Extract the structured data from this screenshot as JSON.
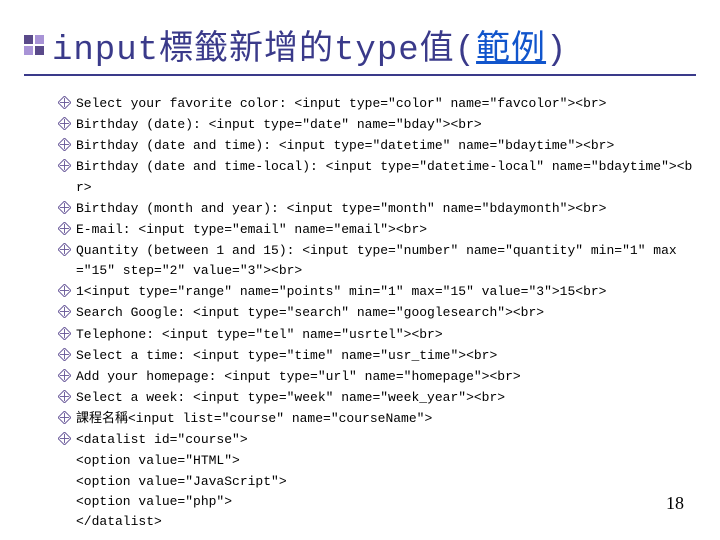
{
  "title": {
    "prefix": "input標籤新增的type值(",
    "link": "範例",
    "suffix": ")"
  },
  "lines": [
    {
      "b": true,
      "t": "Select your favorite color: <input type=\"color\" name=\"favcolor\"><br>"
    },
    {
      "b": true,
      "t": "Birthday (date): <input type=\"date\" name=\"bday\"><br>"
    },
    {
      "b": true,
      "t": "Birthday (date and time): <input type=\"datetime\" name=\"bdaytime\"><br>"
    },
    {
      "b": true,
      "t": "Birthday (date and time-local): <input type=\"datetime-local\" name=\"bdaytime\"><br>"
    },
    {
      "b": true,
      "t": "Birthday (month and year): <input type=\"month\" name=\"bdaymonth\"><br>"
    },
    {
      "b": true,
      "t": "E-mail: <input type=\"email\" name=\"email\"><br>"
    },
    {
      "b": true,
      "t": "Quantity (between 1 and 15): <input type=\"number\" name=\"quantity\" min=\"1\" max=\"15\" step=\"2\" value=\"3\"><br>"
    },
    {
      "b": true,
      "t": "1<input type=\"range\" name=\"points\" min=\"1\" max=\"15\" value=\"3\">15<br>"
    },
    {
      "b": true,
      "t": "Search Google: <input type=\"search\" name=\"googlesearch\"><br>"
    },
    {
      "b": true,
      "t": "Telephone: <input type=\"tel\" name=\"usrtel\"><br>"
    },
    {
      "b": true,
      "t": "Select a time: <input type=\"time\" name=\"usr_time\"><br>"
    },
    {
      "b": true,
      "t": "Add your homepage: <input type=\"url\" name=\"homepage\"><br>"
    },
    {
      "b": true,
      "t": "Select a week: <input type=\"week\" name=\"week_year\"><br>"
    },
    {
      "b": true,
      "t": "課程名稱<input list=\"course\" name=\"courseName\">"
    },
    {
      "b": true,
      "t": "<datalist id=\"course\">"
    },
    {
      "b": false,
      "t": "<option value=\"HTML\">"
    },
    {
      "b": false,
      "t": "<option value=\"JavaScript\">"
    },
    {
      "b": false,
      "t": "<option value=\"php\">"
    },
    {
      "b": false,
      "t": "</datalist>"
    }
  ],
  "pageNumber": "18"
}
